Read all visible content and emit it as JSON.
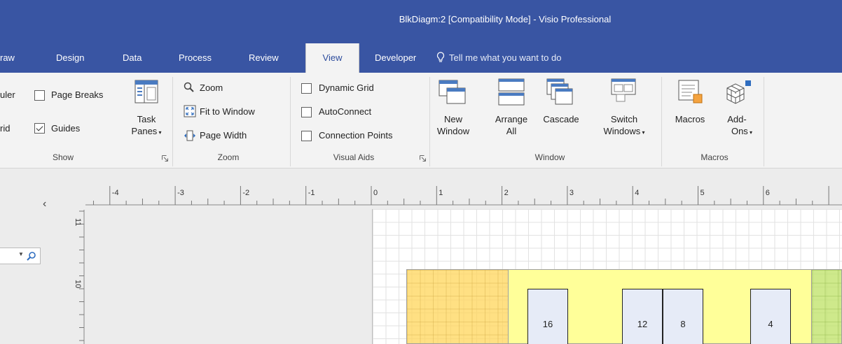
{
  "title": "BlkDiagm:2  [Compatibility Mode]  -  Visio Professional",
  "tabs": [
    {
      "label": "raw"
    },
    {
      "label": "Design"
    },
    {
      "label": "Data"
    },
    {
      "label": "Process"
    },
    {
      "label": "Review"
    },
    {
      "label": "View",
      "active": true
    },
    {
      "label": "Developer"
    }
  ],
  "tell_me": "Tell me what you want to do",
  "ribbon": {
    "show": {
      "ruler": "uler",
      "grid": "rid",
      "page_breaks": {
        "label": "Page Breaks",
        "checked": false
      },
      "guides": {
        "label": "Guides",
        "checked": true
      },
      "task_panes": [
        "Task",
        "Panes"
      ],
      "group_label": "Show"
    },
    "zoom": {
      "zoom": "Zoom",
      "fit": "Fit to Window",
      "page_width": "Page Width",
      "group_label": "Zoom"
    },
    "visual_aids": {
      "dynamic_grid": {
        "label": "Dynamic Grid",
        "checked": false
      },
      "autoconnect": {
        "label": "AutoConnect",
        "checked": false
      },
      "connection_points": {
        "label": "Connection Points",
        "checked": false
      },
      "group_label": "Visual Aids"
    },
    "window": {
      "new_window": [
        "New",
        "Window"
      ],
      "arrange_all": [
        "Arrange",
        "All"
      ],
      "cascade": "Cascade",
      "switch_windows": [
        "Switch",
        "Windows"
      ],
      "group_label": "Window"
    },
    "macros": {
      "macros": "Macros",
      "addons": [
        "Add-",
        "Ons"
      ],
      "group_label": "Macros"
    }
  },
  "ruler": {
    "h_ticks": [
      "-4",
      "-3",
      "-2",
      "-1",
      "0",
      "1",
      "2",
      "3",
      "4",
      "5",
      "6"
    ],
    "v_ticks": [
      "11",
      "10"
    ]
  },
  "diagram": {
    "boxes": [
      "16",
      "12",
      "8",
      "4"
    ]
  },
  "colors": {
    "titlebar": "#3955a3",
    "ribbon": "#f3f3f3",
    "orange_block": "#ffd65a",
    "yellow_block": "#ffff99",
    "green_block": "#bee164",
    "box_fill": "#e6ebf7"
  },
  "icons": [
    "search-icon",
    "lightbulb-icon",
    "zoom-icon",
    "fit-window-icon",
    "page-width-icon",
    "task-panes-icon",
    "new-window-icon",
    "arrange-all-icon",
    "cascade-icon",
    "switch-windows-icon",
    "macros-icon",
    "add-ons-icon",
    "dialog-launcher-icon",
    "collapse-chevron-icon",
    "dropdown-arrow-icon"
  ]
}
